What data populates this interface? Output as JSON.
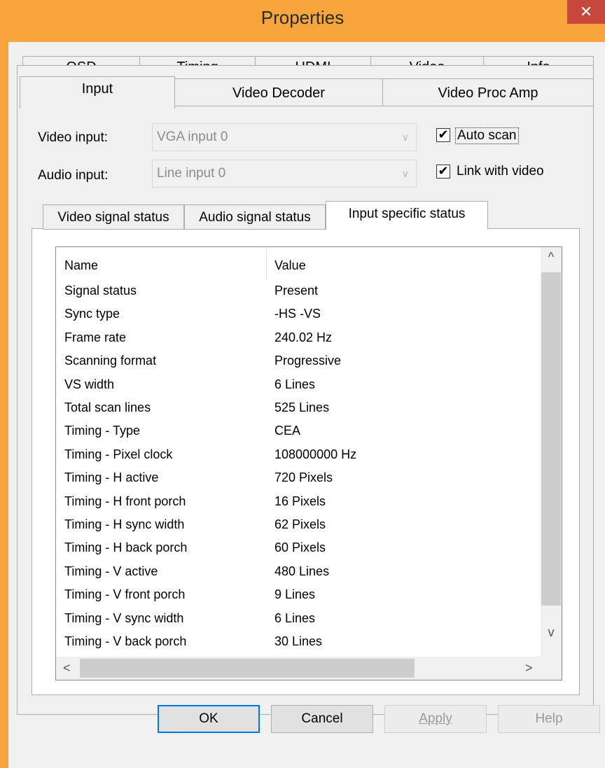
{
  "window": {
    "title": "Properties",
    "close_glyph": "✕"
  },
  "tabs_row1": [
    "OSD",
    "Timing",
    "HDMI",
    "Video",
    "Info"
  ],
  "tabs_row2": [
    "Input",
    "Video Decoder",
    "Video Proc Amp"
  ],
  "video_input": {
    "label": "Video input:",
    "value": "VGA input 0"
  },
  "audio_input": {
    "label": "Audio input:",
    "value": "Line input 0"
  },
  "auto_scan": {
    "label": "Auto scan",
    "checked": true
  },
  "link_video": {
    "label": "Link with video",
    "checked": true
  },
  "status_tabs": [
    "Video signal status",
    "Audio signal status",
    "Input specific status"
  ],
  "table": {
    "columns": [
      "Name",
      "Value"
    ],
    "rows": [
      [
        "Signal status",
        "Present"
      ],
      [
        "Sync type",
        "-HS -VS"
      ],
      [
        "Frame rate",
        "240.02 Hz"
      ],
      [
        "Scanning format",
        "Progressive"
      ],
      [
        "VS width",
        "6 Lines"
      ],
      [
        "Total scan lines",
        "525 Lines"
      ],
      [
        "Timing - Type",
        "CEA"
      ],
      [
        "Timing - Pixel clock",
        "108000000 Hz"
      ],
      [
        "Timing - H active",
        "720 Pixels"
      ],
      [
        "Timing - H front porch",
        "16 Pixels"
      ],
      [
        "Timing - H sync width",
        "62 Pixels"
      ],
      [
        "Timing - H back porch",
        "60 Pixels"
      ],
      [
        "Timing - V active",
        "480 Lines"
      ],
      [
        "Timing - V front porch",
        "9 Lines"
      ],
      [
        "Timing - V sync width",
        "6 Lines"
      ],
      [
        "Timing - V back porch",
        "30 Lines"
      ]
    ]
  },
  "buttons": {
    "ok": "OK",
    "cancel": "Cancel",
    "apply": "Apply",
    "help": "Help"
  },
  "colors": {
    "titlebar": "#f5a53b",
    "close": "#c7463d",
    "dialog_bg": "#f0f0f0"
  },
  "icons": {
    "check": "✔",
    "scroll_up": "^",
    "scroll_down": "v",
    "scroll_left": "<",
    "scroll_right": ">",
    "dropdown": "chevron-down-icon"
  }
}
